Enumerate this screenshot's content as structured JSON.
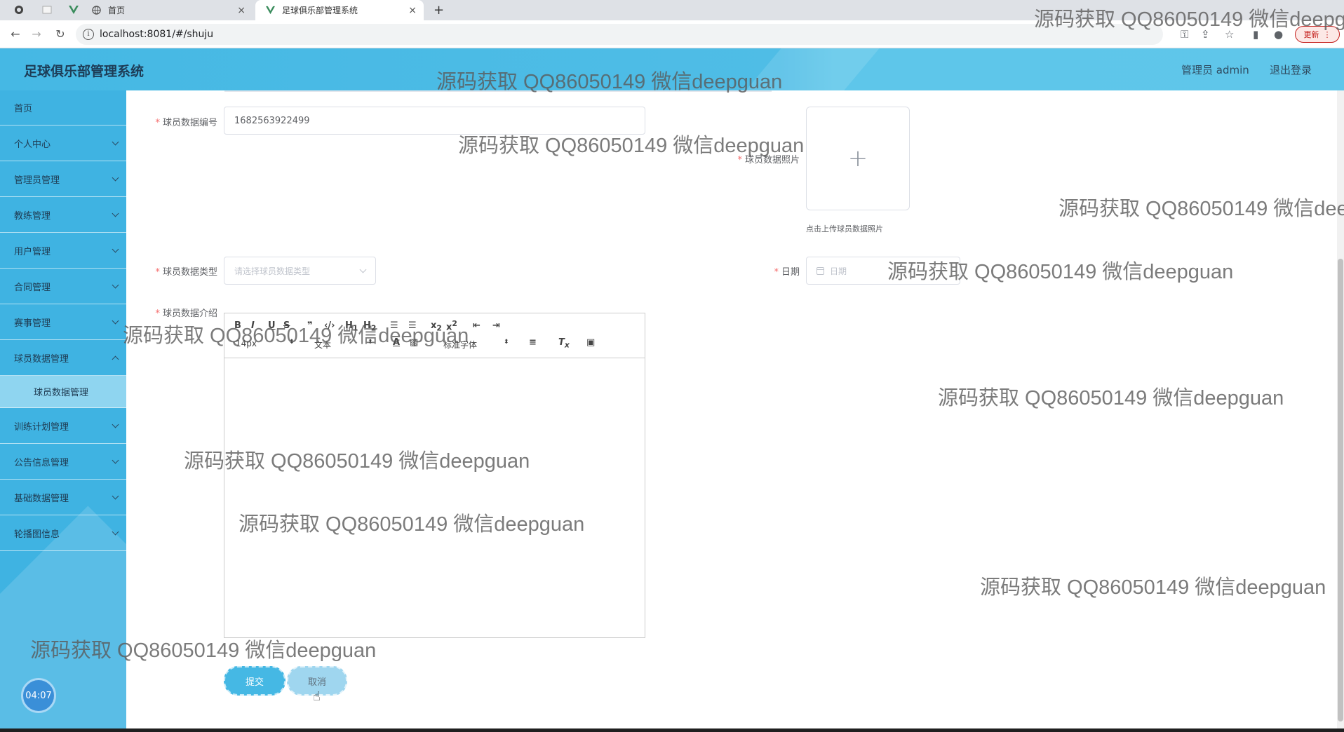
{
  "browser": {
    "tabs": [
      {
        "title": "首页",
        "close": "×"
      },
      {
        "title": "足球俱乐部管理系统",
        "close": "×"
      }
    ],
    "new_tab": "+",
    "url": "localhost:8081/#/shuju",
    "update_label": "更新"
  },
  "header": {
    "title": "足球俱乐部管理系统",
    "user": "管理员 admin",
    "logout": "退出登录"
  },
  "sidebar": {
    "items": [
      {
        "label": "首页"
      },
      {
        "label": "个人中心"
      },
      {
        "label": "管理员管理"
      },
      {
        "label": "教练管理"
      },
      {
        "label": "用户管理"
      },
      {
        "label": "合同管理"
      },
      {
        "label": "赛事管理"
      },
      {
        "label": "球员数据管理"
      },
      {
        "label": "训练计划管理"
      },
      {
        "label": "公告信息管理"
      },
      {
        "label": "基础数据管理"
      },
      {
        "label": "轮播图信息"
      }
    ],
    "sub_item": "球员数据管理",
    "clock": "04:07"
  },
  "form": {
    "required_mark": "*",
    "id_label": "球员数据编号",
    "id_value": "1682563922499",
    "photo_label": "球员数据照片",
    "upload_plus": "+",
    "upload_tip": "点击上传球员数据照片",
    "type_label": "球员数据类型",
    "type_placeholder": "请选择球员数据类型",
    "date_label": "日期",
    "date_placeholder": "日期",
    "intro_label": "球员数据介绍",
    "editor": {
      "font_size": "14px",
      "format": "文本",
      "font_family": "标准字体"
    },
    "submit": "提交",
    "cancel": "取消"
  },
  "watermark_text": "源码获取 QQ86050149 微信deepguan"
}
